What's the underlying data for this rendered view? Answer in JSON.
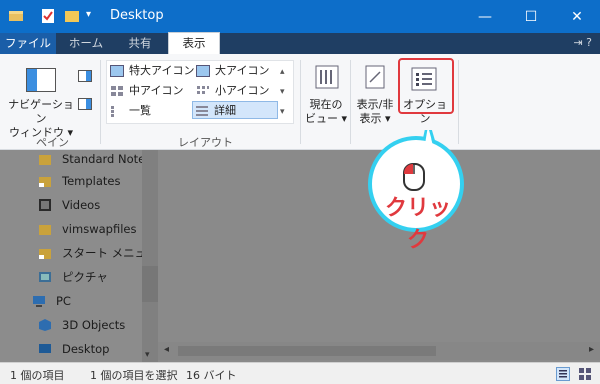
{
  "window": {
    "title": "Desktop"
  },
  "tabs": [
    {
      "label": "ファイル"
    },
    {
      "label": "ホーム"
    },
    {
      "label": "共有"
    },
    {
      "label": "表示"
    }
  ],
  "ribbon": {
    "pane_group": {
      "nav_pane_label_1": "ナビゲーション",
      "nav_pane_label_2": "ウィンドウ ▾",
      "group_label": "ペイン"
    },
    "layout_group": {
      "items": [
        {
          "label": "特大アイコン"
        },
        {
          "label": "大アイコン"
        },
        {
          "label": "中アイコン"
        },
        {
          "label": "小アイコン"
        },
        {
          "label": "一覧"
        },
        {
          "label": "詳細"
        }
      ],
      "group_label": "レイアウト"
    },
    "current_view": {
      "line1": "現在の",
      "line2": "ビュー ▾"
    },
    "show_hide": {
      "line1": "表示/非",
      "line2": "表示 ▾"
    },
    "options": {
      "label": "オプション"
    }
  },
  "nav_pane": {
    "items": [
      {
        "label": "Standard Notes"
      },
      {
        "label": "Templates"
      },
      {
        "label": "Videos"
      },
      {
        "label": "vimswapfiles"
      },
      {
        "label": "スタート メニュー"
      },
      {
        "label": "ピクチャ"
      },
      {
        "label": "PC"
      },
      {
        "label": "3D Objects"
      },
      {
        "label": "Desktop"
      }
    ]
  },
  "status_bar": {
    "count": "1 個の項目",
    "selected": "1 個の項目を選択",
    "size": "16 バイト"
  },
  "callout": {
    "text": "クリック",
    "color": "#e0393e"
  }
}
